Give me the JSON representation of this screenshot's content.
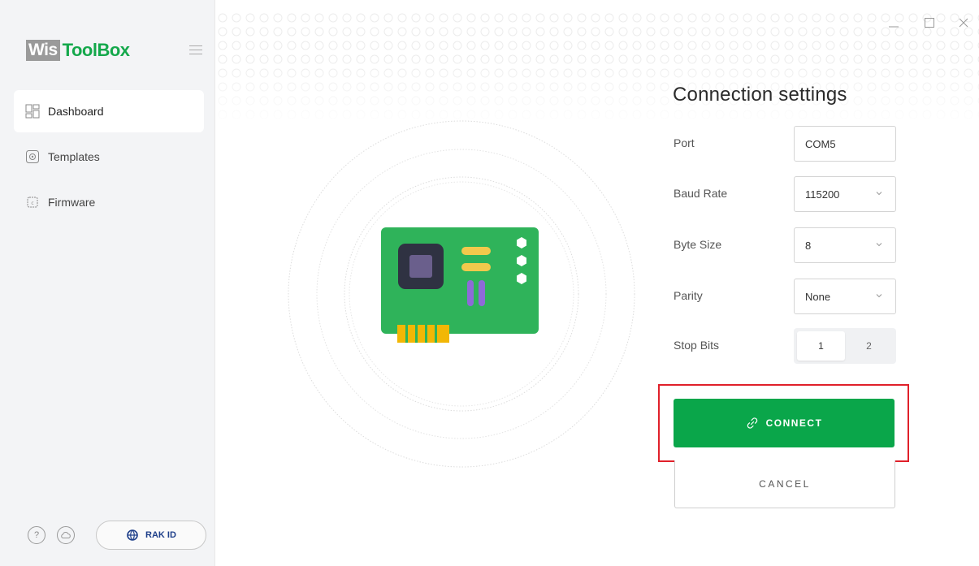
{
  "app": {
    "logo_wis": "Wis",
    "logo_toolbox": "ToolBox"
  },
  "sidebar": {
    "items": [
      {
        "label": "Dashboard",
        "icon": "dashboard-grid-icon",
        "active": true
      },
      {
        "label": "Templates",
        "icon": "templates-icon",
        "active": false
      },
      {
        "label": "Firmware",
        "icon": "firmware-chip-icon",
        "active": false
      }
    ],
    "footer": {
      "help_label": "?",
      "rakid_label": "RAK ID"
    }
  },
  "connection": {
    "title": "Connection settings",
    "port": {
      "label": "Port",
      "value": "COM5"
    },
    "baud_rate": {
      "label": "Baud Rate",
      "value": "115200"
    },
    "byte_size": {
      "label": "Byte Size",
      "value": "8"
    },
    "parity": {
      "label": "Parity",
      "value": "None"
    },
    "stop_bits": {
      "label": "Stop Bits",
      "options": [
        "1",
        "2"
      ],
      "selected": "1"
    },
    "connect_label": "CONNECT",
    "cancel_label": "CANCEL"
  },
  "colors": {
    "brand_green": "#0aa64a",
    "highlight_red": "#e0202a",
    "board_green": "#2fb35a"
  }
}
